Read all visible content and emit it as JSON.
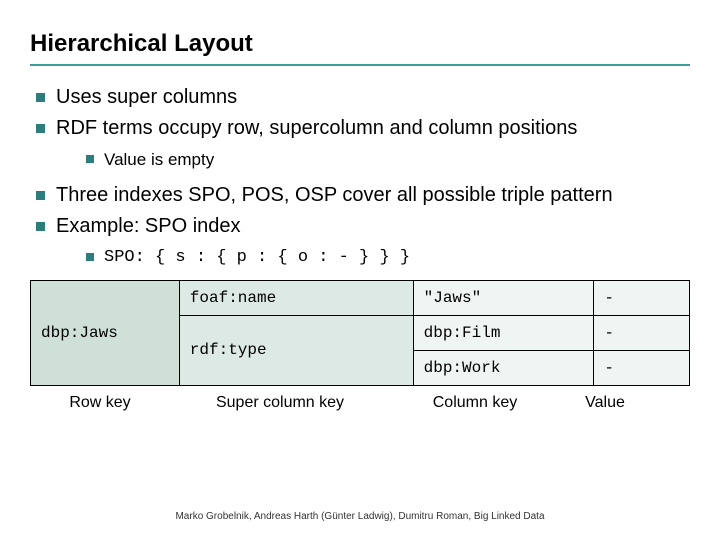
{
  "title": "Hierarchical Layout",
  "bullets": {
    "b1": "Uses super columns",
    "b2": "RDF terms occupy row, supercolumn and column positions",
    "b2_sub": "Value is empty",
    "b3": "Three indexes SPO, POS, OSP cover all possible triple pattern",
    "b4": "Example: SPO index",
    "b4_sub": "SPO: { s : { p : { o : - } } }"
  },
  "table": {
    "rowkey": "dbp:Jaws",
    "p1": "foaf:name",
    "p1_o1": "\"Jaws\"",
    "p1_v1": "-",
    "p2": "rdf:type",
    "p2_o1": "dbp:Film",
    "p2_v1": "-",
    "p2_o2": "dbp:Work",
    "p2_v2": "-"
  },
  "labels": {
    "rowkey": "Row key",
    "superkey": "Super column key",
    "colkey": "Column key",
    "value": "Value"
  },
  "footer": "Marko Grobelnik, Andreas Harth (Günter Ladwig), Dumitru Roman, Big Linked Data"
}
